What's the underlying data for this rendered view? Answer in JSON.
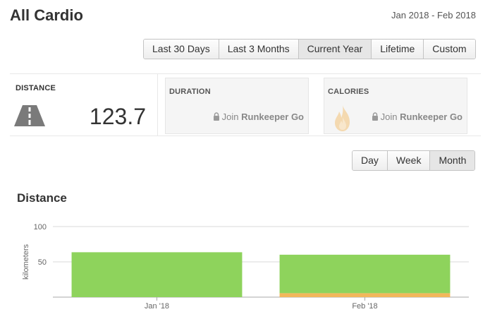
{
  "header": {
    "title": "All Cardio",
    "date_range": "Jan 2018 - Feb 2018"
  },
  "range_buttons": [
    {
      "label": "Last 30 Days",
      "active": false
    },
    {
      "label": "Last 3 Months",
      "active": false
    },
    {
      "label": "Current Year",
      "active": true
    },
    {
      "label": "Lifetime",
      "active": false
    },
    {
      "label": "Custom",
      "active": false
    }
  ],
  "stats": {
    "distance": {
      "label": "DISTANCE",
      "value": "123.7",
      "icon": "road-icon"
    },
    "duration": {
      "label": "DURATION",
      "lock_prefix": "Join ",
      "lock_brand": "Runkeeper Go",
      "icon": "lock-icon"
    },
    "calories": {
      "label": "CALORIES",
      "lock_prefix": "Join ",
      "lock_brand": "Runkeeper Go",
      "icon": "flame-icon"
    }
  },
  "granularity_buttons": [
    {
      "label": "Day",
      "active": false
    },
    {
      "label": "Week",
      "active": false
    },
    {
      "label": "Month",
      "active": true
    }
  ],
  "section": {
    "title": "Distance"
  },
  "colors": {
    "green": "#8ed35c",
    "orange": "#f2b75b",
    "grid": "#d8d8d8"
  },
  "chart_data": {
    "type": "bar",
    "categories": [
      "Jan '18",
      "Feb '18"
    ],
    "series": [
      {
        "color": "#8ed35c",
        "values": [
          63.6,
          54.5
        ]
      },
      {
        "color": "#f2b75b",
        "values": [
          0,
          5.6
        ]
      }
    ],
    "stacked": true,
    "ylabel": "kilometers",
    "ylim": [
      0,
      100
    ],
    "yticks": [
      50,
      100
    ],
    "grid": true
  }
}
